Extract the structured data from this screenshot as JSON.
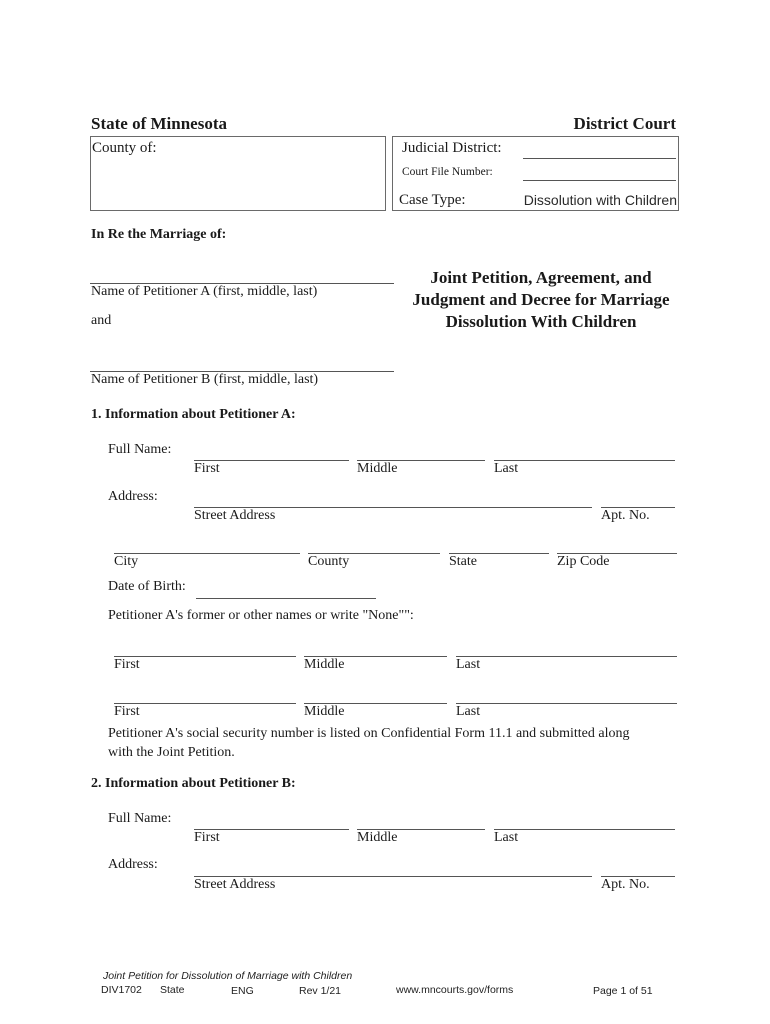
{
  "header": {
    "state": "State of Minnesota",
    "court": "District Court",
    "county_label": "County of:",
    "judicial_district_label": "Judicial District:",
    "court_file_number_label": "Court File Number:",
    "case_type_label": "Case Type:",
    "case_type_value": "Dissolution with Children"
  },
  "caption": {
    "in_re": "In Re the Marriage of:",
    "petitioner_a_label": "Name of Petitioner A (first, middle, last)",
    "and": "and",
    "petitioner_b_label": "Name of Petitioner B (first, middle, last)",
    "document_title": "Joint Petition, Agreement, and Judgment and Decree for Marriage Dissolution With Children"
  },
  "section1": {
    "heading": "1. Information about Petitioner A:",
    "full_name_label": "Full Name:",
    "first": "First",
    "middle": "Middle",
    "last": "Last",
    "address_label": "Address:",
    "street_address": "Street Address",
    "apt_no": "Apt. No.",
    "city": "City",
    "county": "County",
    "state": "State",
    "zip_code": "Zip Code",
    "dob_label": "Date of Birth:",
    "former_names_label": "Petitioner A's former or other names or write \"None\"\":",
    "ssn_note": "Petitioner A's social security number is listed on Confidential Form 11.1 and submitted along",
    "ssn_note_cont": "with the Joint Petition."
  },
  "section2": {
    "heading": "2. Information about Petitioner B:",
    "full_name_label": "Full Name:",
    "first": "First",
    "middle": "Middle",
    "last": "Last",
    "address_label": "Address:",
    "street_address": "Street Address",
    "apt_no": "Apt. No."
  },
  "footer": {
    "form_title": "Joint Petition for Dissolution of Marriage with Children",
    "form_code": "DIV1702",
    "jurisdiction": "State",
    "language": "ENG",
    "revision": "Rev 1/21",
    "website": "www.mncourts.gov/forms",
    "page": "Page 1 of 51"
  }
}
